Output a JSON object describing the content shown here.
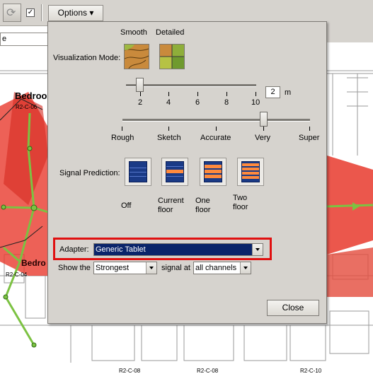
{
  "toolbar": {
    "options_label": "Options ▾",
    "checkbox_mark": "✓",
    "left_input_value": "e"
  },
  "map": {
    "room_labels": [
      "Bedroo",
      "R2-C-06",
      "Bedro",
      "R2-C-04",
      "R2-C-08",
      "R2-C-08",
      "R2-C-10"
    ]
  },
  "options": {
    "thumb_smooth_label": "Smooth",
    "thumb_detailed_label": "Detailed",
    "visualization_mode_label": "Visualization Mode:",
    "size_slider": {
      "ticks": [
        "2",
        "4",
        "6",
        "8",
        "10"
      ],
      "value": "2",
      "unit": "m"
    },
    "quality_slider": {
      "ticks": [
        "Rough",
        "Sketch",
        "Accurate",
        "Very",
        "Super"
      ],
      "selected": "Very"
    },
    "signal_prediction_label": "Signal Prediction:",
    "signal_options": [
      {
        "label": "Off"
      },
      {
        "label": "Current floor"
      },
      {
        "label": "One floor"
      },
      {
        "label": "Two floor"
      }
    ],
    "adapter_label": "Adapter:",
    "adapter_value": "Generic Tablet",
    "show_the_label": "Show the",
    "show_the_value": "Strongest",
    "signal_at_label": "signal at",
    "signal_at_value": "all channels",
    "close_label": "Close"
  },
  "colors": {
    "panel_bg": "#d6d3ce",
    "adapter_highlight": "#e01010",
    "selected_bg": "#0a246a",
    "heat_red": "#e8392d",
    "route_green": "#7cc242"
  }
}
